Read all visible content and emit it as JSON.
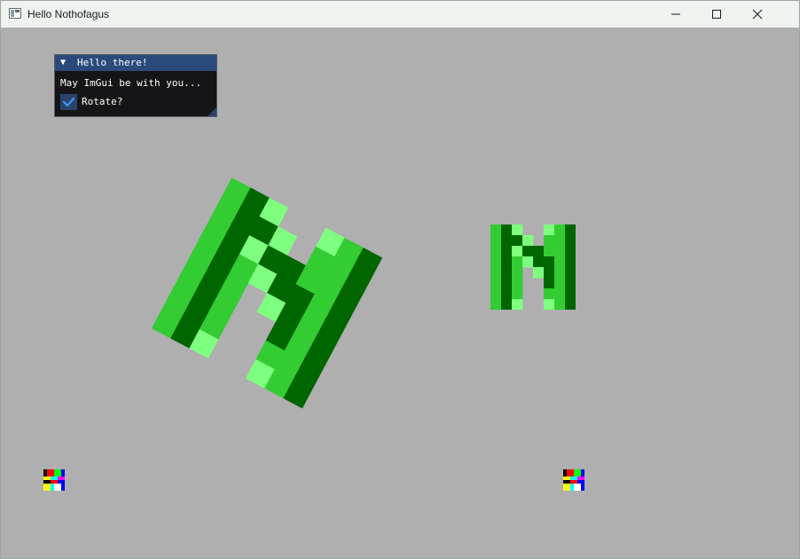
{
  "window": {
    "title": "Hello Nothofagus",
    "background": "#afafaf",
    "controls": {
      "minimize_icon": "minimize-icon",
      "maximize_icon": "maximize-icon",
      "close_icon": "close-icon"
    }
  },
  "imgui": {
    "title": "Hello there!",
    "collapse_arrow": "▼",
    "text": "May ImGui be with you...",
    "checkbox_label": "Rotate?",
    "checkbox_checked": true,
    "colors": {
      "title_bg": "#294a7a",
      "body_bg": "#151517",
      "check_bg": "#29436a",
      "check_mark": "#4296fa"
    }
  },
  "logo": {
    "colors": {
      "dark": "#006600",
      "mid": "#33cc33",
      "light": "#7fff7f"
    },
    "rotated_angle_deg": 28,
    "glyph_icon": "letter-n-icon"
  },
  "texture": {
    "icon": "color-test-texture-icon",
    "colors": [
      "#000000",
      "#ff0000",
      "#00ff00",
      "#0000ff",
      "#ffff00",
      "#00ffff",
      "#ff00ff",
      "#ffffff"
    ]
  }
}
